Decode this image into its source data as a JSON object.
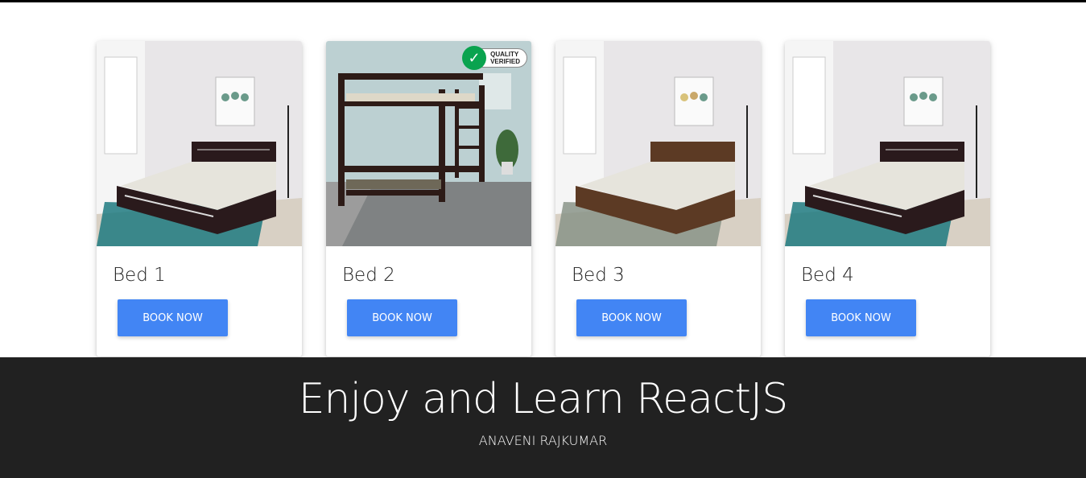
{
  "colors": {
    "button": "#4285f4",
    "footer_bg": "#212121",
    "badge_green": "#0aa34f"
  },
  "cards": [
    {
      "title": "Bed 1",
      "button": "BOOK NOW",
      "image": {
        "kind": "double-bed-dark",
        "rug": "#1f7a80"
      }
    },
    {
      "title": "Bed 2",
      "button": "BOOK NOW",
      "image": {
        "kind": "bunk-bed"
      },
      "badge": {
        "line1": "QUALITY",
        "line2": "VERIFIED",
        "icon": "check-icon"
      }
    },
    {
      "title": "Bed 3",
      "button": "BOOK NOW",
      "image": {
        "kind": "double-bed-brown",
        "rug": "#8a9488"
      }
    },
    {
      "title": "Bed 4",
      "button": "BOOK NOW",
      "image": {
        "kind": "double-bed-dark",
        "rug": "#1f7a80"
      }
    }
  ],
  "footer": {
    "title": "Enjoy and Learn ReactJS",
    "author": "ANAVENI RAJKUMAR"
  }
}
